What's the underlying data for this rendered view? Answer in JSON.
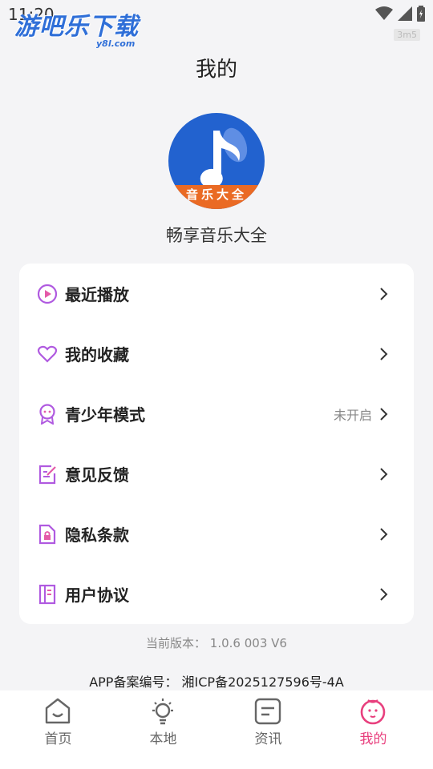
{
  "status_bar": {
    "time": "11:20",
    "watermark_main": "游吧乐下载",
    "watermark_sub": "y8l.com",
    "corner_tag": "3m5"
  },
  "header": {
    "title": "我的"
  },
  "profile": {
    "avatar_band_text": "音乐大全",
    "app_name": "畅享音乐大全"
  },
  "menu": {
    "items": [
      {
        "label": "最近播放",
        "icon": "play-circle-icon",
        "status": ""
      },
      {
        "label": "我的收藏",
        "icon": "heart-icon",
        "status": ""
      },
      {
        "label": "青少年模式",
        "icon": "youth-mode-icon",
        "status": "未开启"
      },
      {
        "label": "意见反馈",
        "icon": "feedback-icon",
        "status": ""
      },
      {
        "label": "隐私条款",
        "icon": "privacy-icon",
        "status": ""
      },
      {
        "label": "用户协议",
        "icon": "agreement-icon",
        "status": ""
      }
    ]
  },
  "footer": {
    "version": "当前版本： 1.0.6 003 V6",
    "icp": "APP备案编号： 湘ICP备2025127596号-4A"
  },
  "bottom_nav": {
    "items": [
      {
        "label": "首页",
        "icon": "home-icon",
        "active": false
      },
      {
        "label": "本地",
        "icon": "lightbulb-icon",
        "active": false
      },
      {
        "label": "资讯",
        "icon": "news-icon",
        "active": false
      },
      {
        "label": "我的",
        "icon": "profile-icon",
        "active": true
      }
    ]
  },
  "colors": {
    "accent": "#e8407e",
    "icon_purple": "#b05ae0",
    "avatar_blue": "#2262cf",
    "avatar_band": "#ea6a24"
  }
}
